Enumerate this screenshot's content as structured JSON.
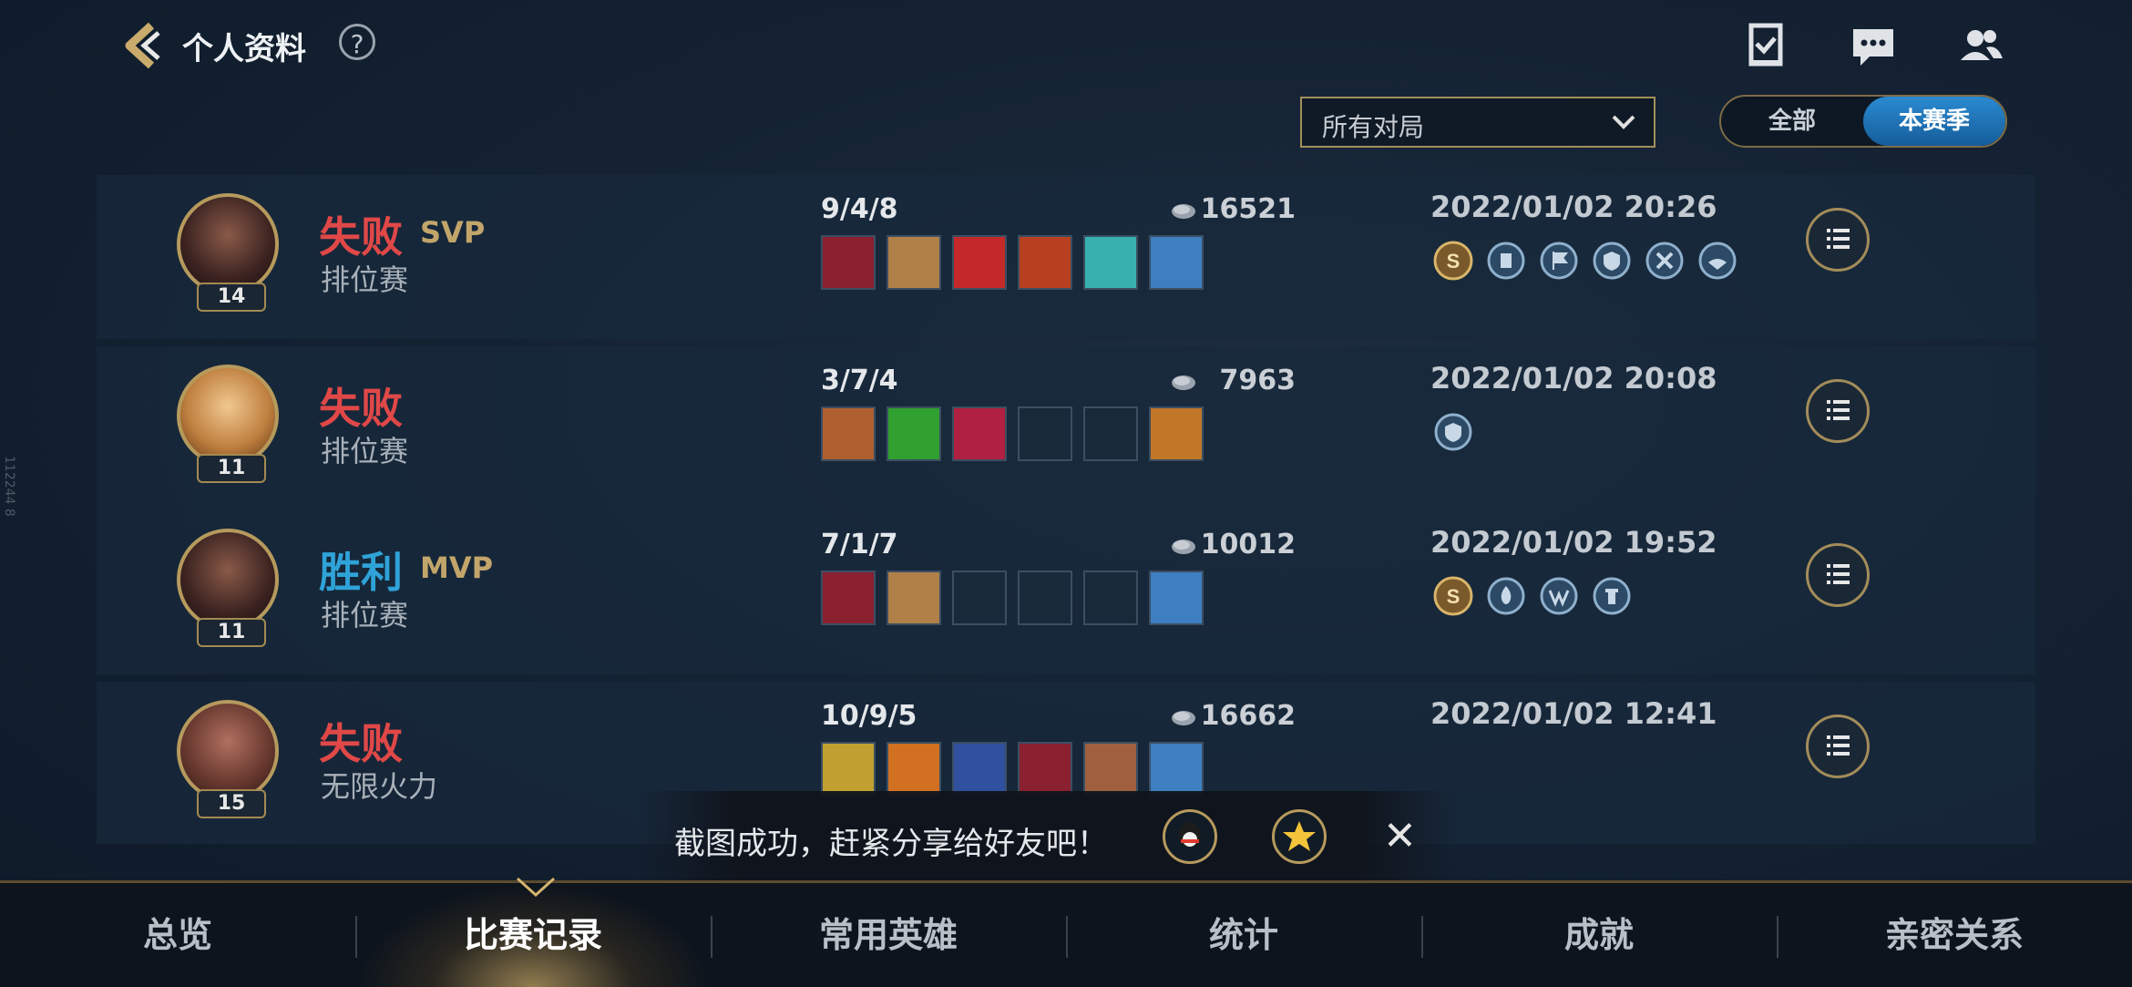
{
  "header": {
    "title": "个人资料",
    "help_label": "?",
    "back_icon": "back-arrow-icon",
    "icons": [
      "task-icon",
      "chat-icon",
      "friends-icon"
    ]
  },
  "filters": {
    "dropdown_value": "所有对局",
    "toggle": [
      "全部",
      "本赛季"
    ],
    "toggle_active": "本赛季"
  },
  "side_id": "112244 8",
  "matches": [
    {
      "level": "14",
      "result": "失败",
      "result_type": "lose",
      "badge": "SVP",
      "mode": "排位赛",
      "kda": "9/4/8",
      "gold": "16521",
      "time": "2022/01/02 20:26",
      "items": [
        "#8a2030",
        "#b08048",
        "#c42828",
        "#b84020",
        "#38b0b0",
        "#3d7fc0"
      ],
      "medals": [
        "S-medal-icon",
        "triple-kill-medal-icon",
        "flag-medal-icon",
        "shield-medal-icon",
        "sword-medal-icon",
        "assist-medal-icon"
      ]
    },
    {
      "level": "11",
      "result": "失败",
      "result_type": "lose",
      "badge": "",
      "mode": "排位赛",
      "kda": "3/7/4",
      "gold": "7963",
      "time": "2022/01/02 20:08",
      "items": [
        "#b06030",
        "#30a030",
        "#b02040",
        "",
        "",
        "#c07828"
      ],
      "medals": [
        "shield-medal-icon"
      ]
    },
    {
      "level": "11",
      "result": "胜利",
      "result_type": "win",
      "badge": "MVP",
      "mode": "排位赛",
      "kda": "7/1/7",
      "gold": "10012",
      "time": "2022/01/02 19:52",
      "items": [
        "#8a2030",
        "#b08048",
        "",
        "",
        "",
        "#3d7fc0"
      ],
      "medals": [
        "S-medal-icon",
        "fire-medal-icon",
        "wing-medal-icon",
        "tower-medal-icon"
      ]
    },
    {
      "level": "15",
      "result": "失败",
      "result_type": "lose",
      "badge": "",
      "mode": "无限火力",
      "kda": "10/9/5",
      "gold": "16662",
      "time": "2022/01/02 12:41",
      "items": [
        "#c0a030",
        "#d07020",
        "#3050a0",
        "#8a2030",
        "#a06040",
        "#3d7fc0"
      ],
      "medals": []
    }
  ],
  "toast": {
    "text": "截图成功，赶紧分享给好友吧！",
    "share_icons": [
      "qq-icon",
      "qzone-star-icon"
    ],
    "close_label": "✕"
  },
  "tabs": [
    "总览",
    "比赛记录",
    "常用英雄",
    "统计",
    "成就",
    "亲密关系"
  ],
  "active_tab": "比赛记录"
}
